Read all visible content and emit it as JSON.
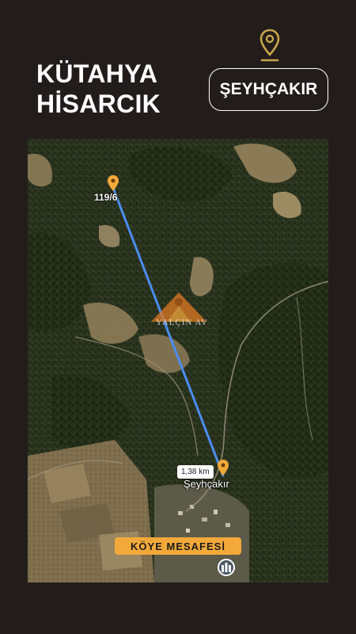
{
  "header": {
    "title_line1": "KÜTAHYA",
    "title_line2": "HİSARCIK",
    "village_name": "ŞEYHÇAKIR",
    "pin_icon": "location-pin-icon",
    "pin_color": "#c9a64a"
  },
  "map": {
    "parcel_label": "119/6",
    "distance_label": "1,38 km",
    "village_label": "Şeyhçakır",
    "caption": "KÖYE MESAFESİ",
    "watermark_text": "YALÇIN AV",
    "marker_color": "#f3a93a",
    "route_color": "#4a8df0",
    "caption_bg": "#f3a93a",
    "poi_icon": "building-poi-icon"
  }
}
